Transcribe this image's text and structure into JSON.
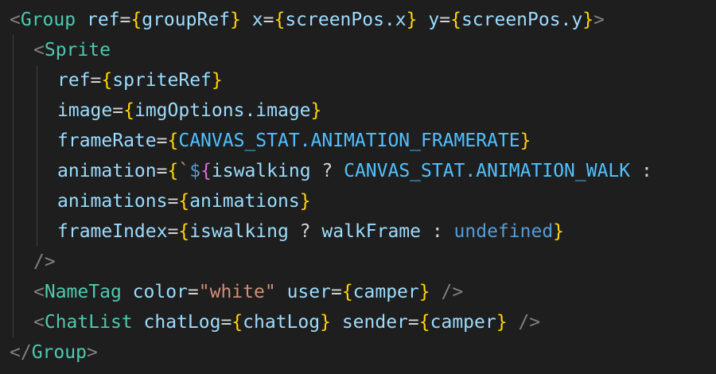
{
  "code": {
    "line1": {
      "open": "<",
      "tag": "Group",
      "a1": "ref",
      "eq1": "=",
      "b1o": "{",
      "v1": "groupRef",
      "b1c": "}",
      "a2": "x",
      "eq2": "=",
      "b2o": "{",
      "v2": "screenPos.x",
      "b2c": "}",
      "a3": "y",
      "eq3": "=",
      "b3o": "{",
      "v3": "screenPos.y",
      "b3c": "}",
      "close": ">"
    },
    "line2": {
      "open": "<",
      "tag": "Sprite"
    },
    "line3": {
      "attr": "ref",
      "eq": "=",
      "bo": "{",
      "val": "spriteRef",
      "bc": "}"
    },
    "line4": {
      "attr": "image",
      "eq": "=",
      "bo": "{",
      "val": "imgOptions.image",
      "bc": "}"
    },
    "line5": {
      "attr": "frameRate",
      "eq": "=",
      "bo": "{",
      "val": "CANVAS_STAT.ANIMATION_FRAMERATE",
      "bc": "}"
    },
    "line6": {
      "attr": "animation",
      "eq": "=",
      "bo": "{",
      "tick": "`",
      "dollar": "$",
      "b2o": "{",
      "cond": "iswalking",
      "q": " ? ",
      "val": "CANVAS_STAT.ANIMATION_WALK",
      "rest": " :"
    },
    "line7": {
      "attr": "animations",
      "eq": "=",
      "bo": "{",
      "val": "animations",
      "bc": "}"
    },
    "line8": {
      "attr": "frameIndex",
      "eq": "=",
      "bo": "{",
      "cond": "iswalking",
      "q": " ? ",
      "val": "walkFrame",
      "colon": " : ",
      "kw": "undefined",
      "bc": "}"
    },
    "line9": {
      "close": "/>"
    },
    "line10": {
      "open": "<",
      "tag": "NameTag",
      "a1": "color",
      "eq1": "=",
      "s1": "\"white\"",
      "a2": "user",
      "eq2": "=",
      "bo": "{",
      "v2": "camper",
      "bc": "}",
      "close": "/>"
    },
    "line11": {
      "open": "<",
      "tag": "ChatList",
      "a1": "chatLog",
      "eq1": "=",
      "b1o": "{",
      "v1": "chatLog",
      "b1c": "}",
      "a2": "sender",
      "eq2": "=",
      "b2o": "{",
      "v2": "camper",
      "b2c": "}",
      "close": "/>"
    },
    "line12": {
      "open": "</",
      "tag": "Group",
      "close": ">"
    }
  }
}
